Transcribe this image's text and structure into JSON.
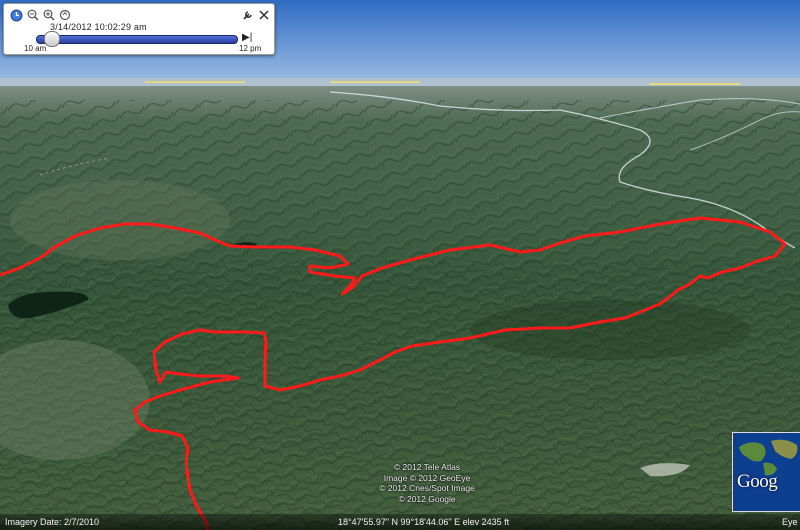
{
  "time_slider": {
    "date_time": "3/14/2012  10:02:29 am",
    "start_label": "10 am",
    "end_label": "12 pm",
    "position_fraction": 0.04,
    "icons": [
      "clock-icon",
      "zoom-out-icon",
      "zoom-in-icon",
      "animation-speed-icon",
      "settings-wrench-icon",
      "close-icon",
      "step-end-icon"
    ]
  },
  "credits": [
    "© 2012 Tele Atlas",
    "Image © 2012 GeoEye",
    "© 2012 Cnes/Spot Image",
    "© 2012 Google"
  ],
  "status_bar": {
    "imagery_date": "Imagery Date: 2/7/2010",
    "coordinates": "18°47'55.97\" N   99°18'44.06\" E  elev  2435 ft",
    "eye_label": "Eye"
  },
  "thumbnail": {
    "logo_text": "Goog"
  },
  "colors": {
    "route": "#ff1a1a",
    "sky": "#5a8fd6",
    "terrain": "#3a5a3c",
    "roads": "#d8dde6"
  }
}
